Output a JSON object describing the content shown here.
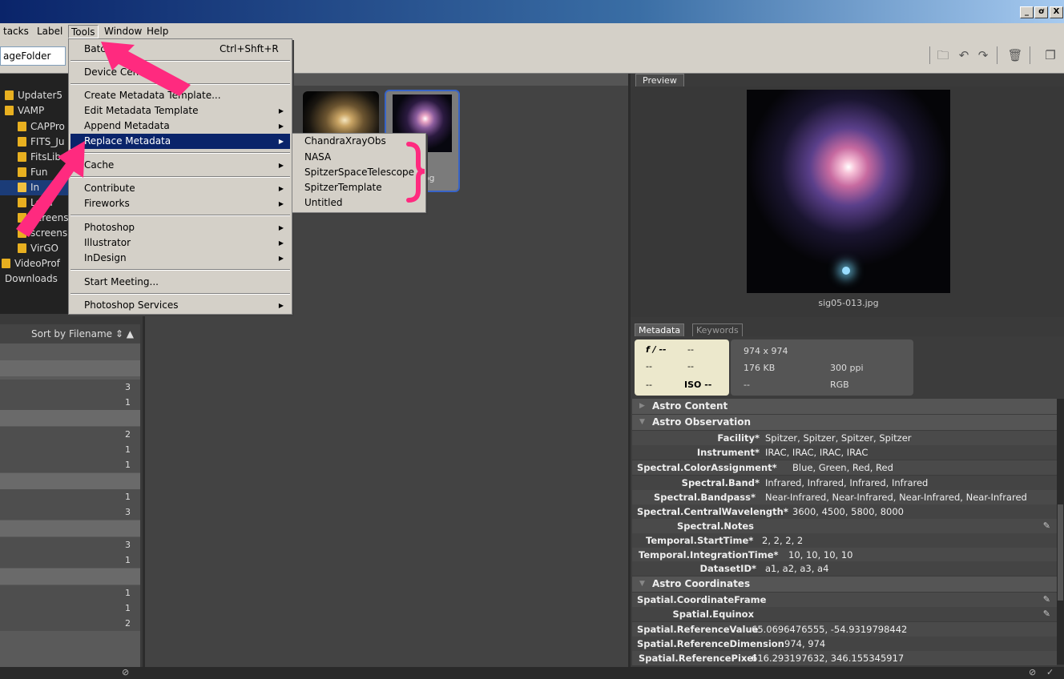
{
  "window": {
    "min": "_",
    "max": "ơ",
    "close": "X"
  },
  "menubar": [
    {
      "label": "tacks"
    },
    {
      "label": "Label"
    },
    {
      "label": "Tools"
    },
    {
      "label": "Window"
    },
    {
      "label": "Help"
    }
  ],
  "toolbar": {
    "path": "ageFolder"
  },
  "folders": [
    {
      "name": "Updater5"
    },
    {
      "name": "VAMP"
    },
    {
      "name": "CAPPro"
    },
    {
      "name": "FITS_Ju"
    },
    {
      "name": "FitsLib"
    },
    {
      "name": "Fun"
    },
    {
      "name": "In"
    },
    {
      "name": "Loca"
    },
    {
      "name": "Screens"
    },
    {
      "name": "screens"
    },
    {
      "name": "VirGO"
    },
    {
      "name": "VideoProf"
    },
    {
      "name": "Downloads"
    }
  ],
  "filter": {
    "sort_label": "Sort by Filename",
    "counts": [
      "3",
      "1",
      "2",
      "1",
      "1",
      "1",
      "3",
      "3",
      "1",
      "1",
      "1",
      "2"
    ]
  },
  "tools_menu": {
    "items": [
      {
        "label": "Batch...",
        "shortcut": "Ctrl+Shft+R"
      },
      {
        "label": "Device Central..."
      },
      {
        "label": "Create Metadata Template..."
      },
      {
        "label": "Edit Metadata Template"
      },
      {
        "label": "Append Metadata"
      },
      {
        "label": "Replace Metadata"
      },
      {
        "label": "Cache"
      },
      {
        "label": "Contribute"
      },
      {
        "label": "Fireworks"
      },
      {
        "label": "Photoshop"
      },
      {
        "label": "Illustrator"
      },
      {
        "label": "InDesign"
      },
      {
        "label": "Start Meeting..."
      },
      {
        "label": "Photoshop Services"
      }
    ]
  },
  "replace_submenu": [
    "ChandraXrayObs",
    "NASA",
    "SpitzerSpaceTelescope",
    "SpitzerTemplate",
    "Untitled"
  ],
  "thumbnail": {
    "label": ".jpg"
  },
  "preview": {
    "tab": "Preview",
    "filename": "sig05-013.jpg"
  },
  "metadata": {
    "tabs": [
      "Metadata",
      "Keywords"
    ],
    "camera": {
      "aperture": "f / --",
      "shutter": "--",
      "r2a": "--",
      "r2b": "--",
      "r3a": "--",
      "iso": "ISO --"
    },
    "file": {
      "dimensions": "974 x 974",
      "size": "176 KB",
      "resolution": "300 ppi",
      "dash": "--",
      "mode": "RGB"
    },
    "sections": {
      "content": "Astro Content",
      "observation": "Astro Observation",
      "coordinates": "Astro Coordinates"
    },
    "observation": [
      {
        "label": "Facility*",
        "value": "Spitzer, Spitzer, Spitzer, Spitzer"
      },
      {
        "label": "Instrument*",
        "value": "IRAC, IRAC, IRAC, IRAC"
      },
      {
        "label": "Spectral.ColorAssignment*",
        "value": "Blue, Green, Red, Red"
      },
      {
        "label": "Spectral.Band*",
        "value": "Infrared, Infrared, Infrared, Infrared"
      },
      {
        "label": "Spectral.Bandpass*",
        "value": "Near-Infrared, Near-Infrared, Near-Infrared, Near-Infrared"
      },
      {
        "label": "Spectral.CentralWavelength*",
        "value": "3600, 4500, 5800, 8000"
      },
      {
        "label": "Spectral.Notes",
        "value": ""
      },
      {
        "label": "Temporal.StartTime*",
        "value": "2, 2, 2, 2"
      },
      {
        "label": "Temporal.IntegrationTime*",
        "value": "10, 10, 10, 10"
      },
      {
        "label": "DatasetID*",
        "value": "a1, a2, a3, a4"
      }
    ],
    "coordinates": [
      {
        "label": "Spatial.CoordinateFrame",
        "value": ""
      },
      {
        "label": "Spatial.Equinox",
        "value": ""
      },
      {
        "label": "Spatial.ReferenceValue",
        "value": "65.0696476555, -54.9319798442"
      },
      {
        "label": "Spatial.ReferenceDimension",
        "value": "974, 974"
      },
      {
        "label": "Spatial.ReferencePixel",
        "value": "616.293197632, 346.155345917"
      }
    ]
  },
  "colors": {
    "accent": "#ff2a7f",
    "highlight": "#0a246a"
  }
}
